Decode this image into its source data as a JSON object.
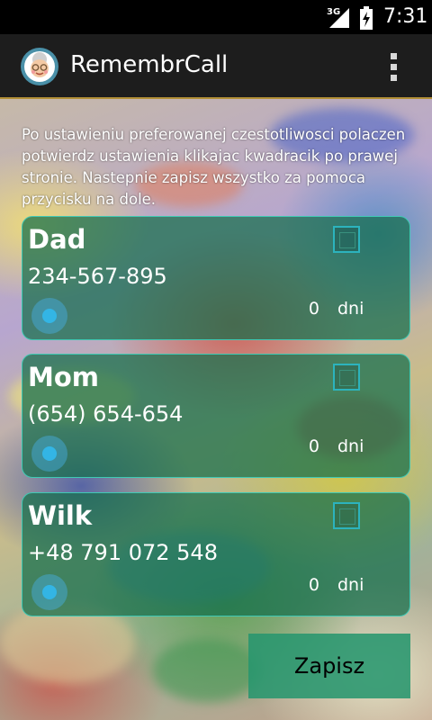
{
  "status_bar": {
    "network": "3G",
    "time": "7:31",
    "icons": [
      "signal-icon",
      "battery-charging-icon"
    ]
  },
  "action_bar": {
    "title": "RemembrCall",
    "app_icon": "grandma-avatar-icon",
    "overflow_icon": "overflow-menu-icon"
  },
  "instructions": "Po ustawieniu preferowanej czestotliwosci polaczen potwierdz ustawienia klikajac kwadracik po prawej stronie. Nastepnie zapisz wszystko za pomoca przycisku na dole.",
  "contacts": [
    {
      "name": "Dad",
      "phone": "234-567-895",
      "days": "0",
      "unit": "dni",
      "checked": false,
      "slider_value": 0
    },
    {
      "name": "Mom",
      "phone": "(654) 654-654",
      "days": "0",
      "unit": "dni",
      "checked": false,
      "slider_value": 0
    },
    {
      "name": "Wilk",
      "phone": "+48 791 072 548",
      "days": "0",
      "unit": "dni",
      "checked": false,
      "slider_value": 0
    }
  ],
  "save_button": {
    "label": "Zapisz"
  },
  "colors": {
    "accent": "#33b5e5",
    "card_border": "#3fc9b4",
    "card_fill": "#146e4b",
    "action_bar_underline": "#b28f36"
  }
}
